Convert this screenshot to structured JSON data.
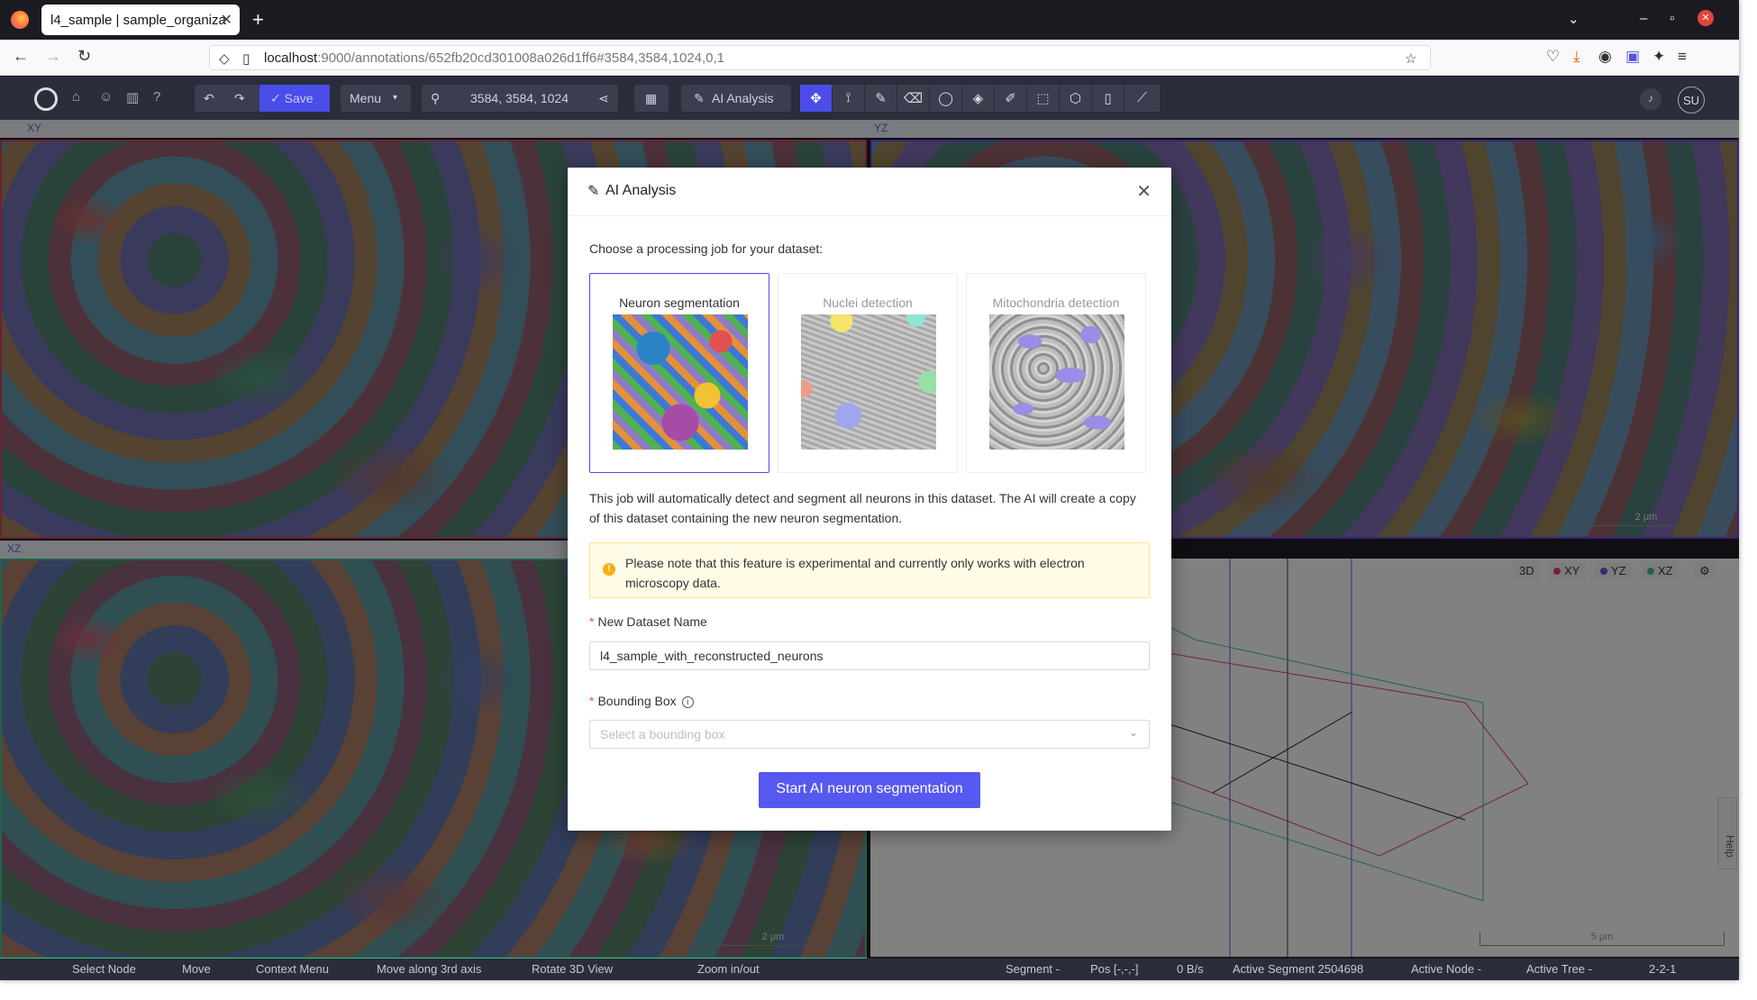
{
  "browser": {
    "tab_title": "l4_sample | sample_organiza",
    "url_host": "localhost",
    "url_rest": ":9000/annotations/652fb20cd301008a026d1ff6#3584,3584,1024,0,1"
  },
  "toolbar": {
    "save_label": "Save",
    "menu_label": "Menu",
    "position": "3584, 3584, 1024",
    "ai_analysis_label": "AI Analysis",
    "user_initials": "SU"
  },
  "viewports": {
    "xy": "XY",
    "yz": "YZ",
    "xz": "XZ",
    "scale_xy": "2 μm",
    "scale_xz": "2 μm",
    "scale_3d": "5 μm",
    "btn_3d": "3D",
    "btn_xy": "XY",
    "btn_yz": "YZ",
    "btn_xz": "XZ",
    "help": "Help"
  },
  "modal": {
    "title": "AI Analysis",
    "prompt": "Choose a processing job for your dataset:",
    "jobs": [
      {
        "label": "Neuron segmentation"
      },
      {
        "label": "Nuclei detection"
      },
      {
        "label": "Mitochondria detection"
      }
    ],
    "description": "This job will automatically detect and segment all neurons in this dataset. The AI will create a copy of this dataset containing the new neuron segmentation.",
    "alert": "Please note that this feature is experimental and currently only works with electron microscopy data.",
    "dataset_name_label": "New Dataset Name",
    "dataset_name_value": "l4_sample_with_reconstructed_neurons",
    "bbox_label": "Bounding Box",
    "bbox_placeholder": "Select a bounding box",
    "start_button": "Start AI neuron segmentation"
  },
  "status": {
    "select_node": "Select Node",
    "move": "Move",
    "context_menu": "Context Menu",
    "move_3rd": "Move along 3rd axis",
    "rotate": "Rotate 3D View",
    "zoom": "Zoom in/out",
    "segment": "Segment -",
    "pos": "Pos [-,-,-]",
    "rate": "0 B/s",
    "active_segment": "Active Segment 2504698",
    "active_node": "Active Node -",
    "active_tree": "Active Tree -",
    "mag": "2-2-1"
  }
}
